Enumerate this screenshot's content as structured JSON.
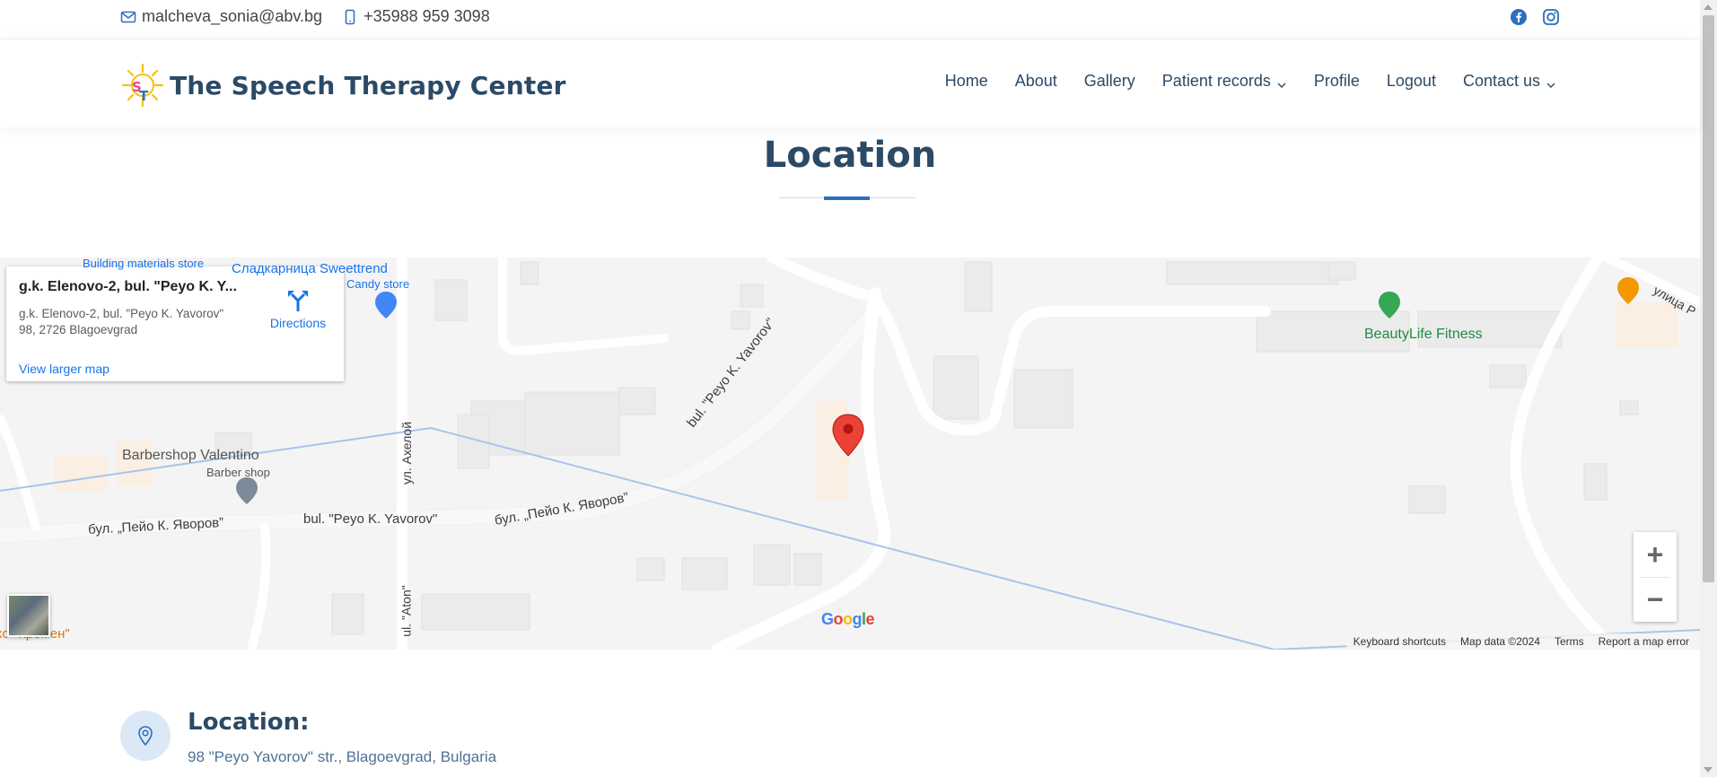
{
  "topbar": {
    "email": "malcheva_sonia@abv.bg",
    "phone": "+35988 959 3098",
    "email_icon": "envelope-icon",
    "phone_icon": "phone-icon",
    "social": [
      "facebook-icon",
      "instagram-icon"
    ]
  },
  "header": {
    "brand": "The Speech Therapy Center",
    "logo_letters": [
      "S",
      "T"
    ],
    "nav": [
      {
        "label": "Home"
      },
      {
        "label": "About"
      },
      {
        "label": "Gallery"
      },
      {
        "label": "Patient records",
        "dropdown": true
      },
      {
        "label": "Profile"
      },
      {
        "label": "Logout"
      },
      {
        "label": "Contact us",
        "dropdown": true
      }
    ]
  },
  "section": {
    "title": "Location"
  },
  "map": {
    "place_name": "g.k. Elenovo-2, bul. \"Peyo K. Y...",
    "address_line1": "g.k. Elenovo-2, bul. \"Peyo K. Yavorov\"",
    "address_line2": "98, 2726 Blagoevgrad",
    "directions": "Directions",
    "view_larger": "View larger map",
    "labels": {
      "building_store": "Building materials store",
      "sweettrend": "Сладкарница Sweettrend",
      "candy_store": "Candy store",
      "beautylife": "BeautyLife Fitness",
      "ulitsa": "улица Р",
      "barbershop": "Barbershop Valentino",
      "barber_shop": "Barber shop",
      "ul_aheloy": "ул. Ахелой",
      "bul_peyo_cyr_left": "бул. „Пейо К. Яворов”",
      "bul_peyo_lat_mid": "bul. \"Peyo K. Yavorov\"",
      "bul_peyo_cyr_mid": "бул. „Пейо К. Яворов”",
      "bul_peyo_lat_diag": "bul. \"Peyo K. Yavorov\"",
      "ul_aton": "ul. \"Aton\"",
      "kremen": "ско \"Кремен\""
    },
    "google": "Google",
    "footer": [
      "Keyboard shortcuts",
      "Map data ©2024",
      "Terms",
      "Report a map error"
    ],
    "zoom_in": "+",
    "zoom_out": "−"
  },
  "location": {
    "heading": "Location:",
    "text": "98 \"Peyo Yavorov\" str., Blagoevgrad, Bulgaria",
    "icon": "map-pin-icon"
  },
  "colors": {
    "accent": "#2c6fbb",
    "heading": "#2b4a66",
    "map_link": "#1a73e8",
    "marker": "#ea4335"
  }
}
